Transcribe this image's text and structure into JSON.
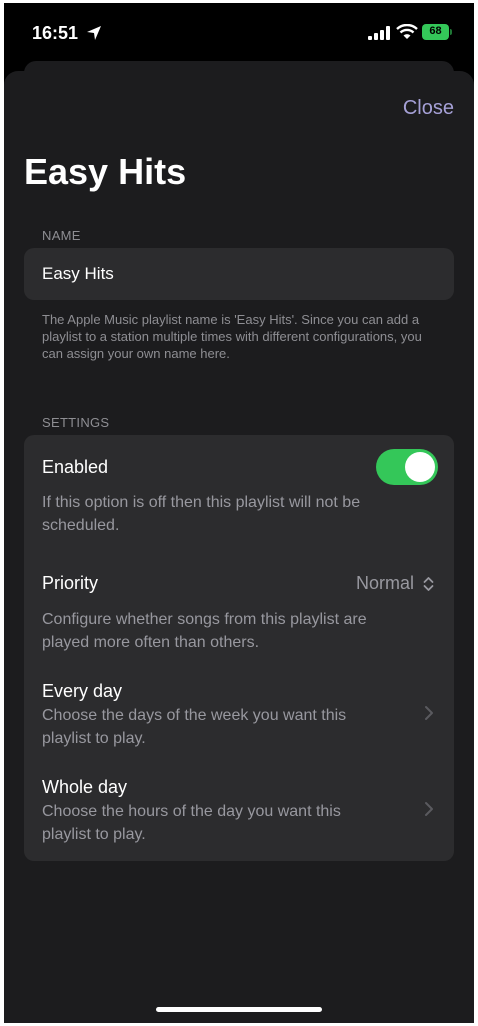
{
  "status_bar": {
    "time": "16:51",
    "battery": "68"
  },
  "sheet": {
    "close_label": "Close",
    "title": "Easy Hits"
  },
  "name_section": {
    "header": "NAME",
    "value": "Easy Hits",
    "footnote": "The Apple Music playlist name is 'Easy Hits'. Since you can add a playlist to a station multiple times with different configurations, you can assign your own name here."
  },
  "settings_section": {
    "header": "SETTINGS",
    "enabled": {
      "title": "Enabled",
      "description": "If this option is off then this playlist will not be scheduled.",
      "on": true
    },
    "priority": {
      "title": "Priority",
      "value": "Normal",
      "description": "Configure whether songs from this playlist are played more often than others."
    },
    "days": {
      "title": "Every day",
      "description": "Choose the days of the week you want this playlist to play."
    },
    "hours": {
      "title": "Whole day",
      "description": "Choose the hours of the day you want this playlist to play."
    }
  },
  "colors": {
    "accent": "#a5a0d6",
    "toggle_on": "#34c759",
    "background": "#1c1c1e",
    "cell": "#2c2c2e"
  }
}
